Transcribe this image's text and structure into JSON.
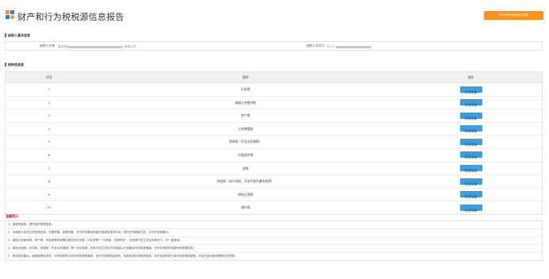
{
  "header": {
    "title": "财产和行为税税源信息报告",
    "top_button": "财产和行为税综合申报"
  },
  "taxpayer": {
    "section_title": "纳税人基本信息",
    "name_label": "纳税人名称",
    "name_prefix": "泰安市",
    "name_suffix": "有限公司",
    "id_label": "纳税人识别号",
    "id_prefix": "9137"
  },
  "tax_types": {
    "section_title": "税种类信息",
    "headers": {
      "no": "序号",
      "tax": "税种",
      "op": "操作"
    },
    "op_label": "税源采集",
    "rows": [
      {
        "no": "1",
        "tax": "印花税"
      },
      {
        "no": "2",
        "tax": "城镇土地使用税"
      },
      {
        "no": "3",
        "tax": "房产税"
      },
      {
        "no": "4",
        "tax": "土地增值税"
      },
      {
        "no": "5",
        "tax": "资源税（不含水资源税）"
      },
      {
        "no": "6",
        "tax": "环境保护税"
      },
      {
        "no": "7",
        "tax": "契税"
      },
      {
        "no": "8",
        "tax": "车船税（自行申报，不含代收代缴车船税）"
      },
      {
        "no": "9",
        "tax": "耕地占用税"
      },
      {
        "no": "10",
        "tax": "烟叶税"
      }
    ]
  },
  "tips": {
    "title": "温馨提示",
    "lines": [
      "1、纳税申报前，需先维护税源信息；",
      "2、对纳税义务发生的税源信息，无需采集。若需采集，您可供采集选择维护税源信息的时间；同时在申报期之前，也可在申报期内；",
      "3、城镇土地使用税、房产税、车船税等税源需由税务机关采集，印花税等“一次采集，长期有效”，在税源不发生变化的情况下，可一直使用；",
      "4、耕地占用税、印花税、资源税（不含水资源税）等一次性税源，若有不发生变化的可直接以已采集填写的税源明细，也可在申报时填报所有税源信息；",
      "5、税信息采集后，填报税源信息时，可查询修改已填写的税源明细表。如所在税源信息缺失，申报前请补录税源信息，到可查询修改已填写的税源明细表，然后在此页面申报需正常申报；"
    ]
  }
}
